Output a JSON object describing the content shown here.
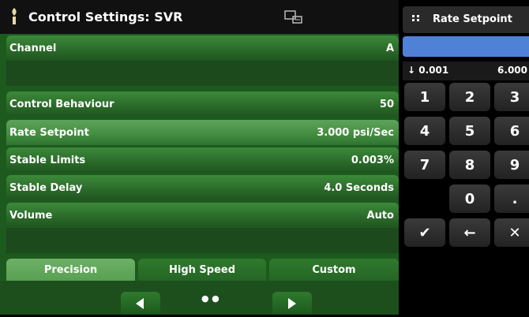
{
  "title": {
    "text": "Control Settings: SVR",
    "icon": "torch-icon",
    "status_icon": "remote-display-icon"
  },
  "settings": [
    {
      "label": "Channel",
      "value": "A"
    },
    {
      "label": "Control Behaviour",
      "value": "50"
    },
    {
      "label": "Rate Setpoint",
      "value": "3.000 psi/Sec"
    },
    {
      "label": "Stable Limits",
      "value": "0.003%"
    },
    {
      "label": "Stable Delay",
      "value": "4.0 Seconds"
    },
    {
      "label": "Volume",
      "value": "Auto"
    }
  ],
  "tabs": {
    "precision": "Precision",
    "high_speed": "High Speed",
    "custom": "Custom",
    "active": "Precision"
  },
  "pager": {
    "dots": "● ●",
    "prev_icon": "left-arrow-icon",
    "next_icon": "right-arrow-icon"
  },
  "keypad": {
    "title": "Rate Setpoint",
    "title_icon": "keypad-icon",
    "entry_value": "",
    "range_min": "↓ 0.001",
    "range_max": "6.000",
    "keys": [
      "1",
      "2",
      "3",
      "4",
      "5",
      "6",
      "7",
      "8",
      "9",
      "0",
      "."
    ],
    "enter_glyph": "✔",
    "back_glyph": "←",
    "cancel_glyph": "✕"
  },
  "colors": {
    "panel_green": "#1c5a1e",
    "selected_green": "#5ea35a",
    "entry_blue": "#4f82d6"
  }
}
